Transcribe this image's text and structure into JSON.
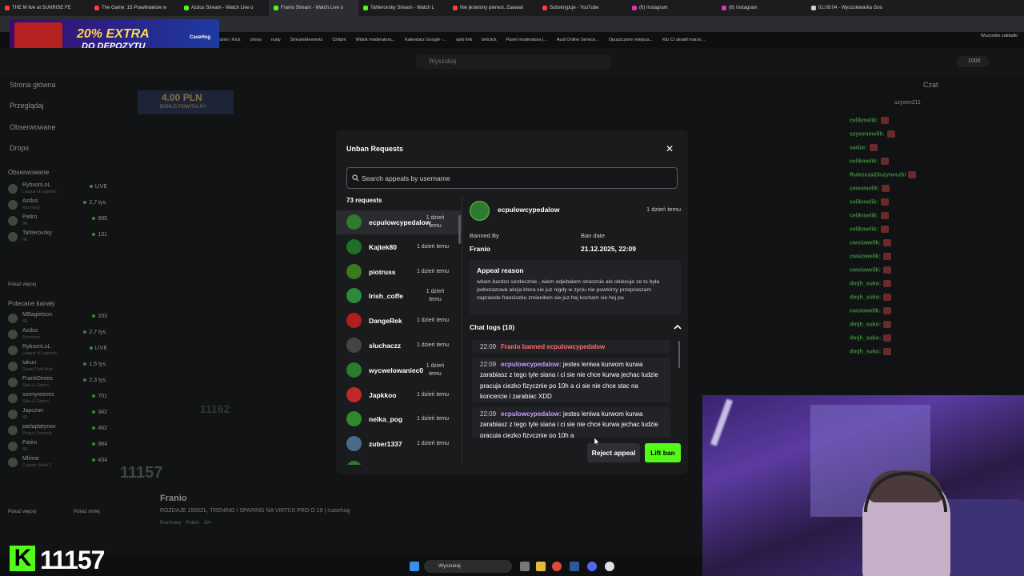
{
  "browser": {
    "tabs": [
      {
        "label": "THE M live at SUNRISE FE",
        "color": "#ff3b3b"
      },
      {
        "label": "The Game: 15 Prawilniaków w",
        "color": "#ff3b3b"
      },
      {
        "label": "Azdus Stream - Watch Live o",
        "color": "#53fc18"
      },
      {
        "label": "Franio Stream - Watch Live o",
        "color": "#53fc18"
      },
      {
        "label": "Tahlerovsky Stream - Watch L",
        "color": "#53fc18"
      },
      {
        "label": "Nie jesteśmy pierwsi. Zaawan",
        "color": "#ff3b3b"
      },
      {
        "label": "Subskrypcje - YouTube",
        "color": "#ff3b3b"
      },
      {
        "label": "(6) Instagram",
        "color": "#d63ab5"
      },
      {
        "label": "(6) Instagram",
        "color": "#d63ab5"
      },
      {
        "label": "01:09:04 - Wyszukiwarka Goo",
        "color": "#cccccc"
      }
    ],
    "bookmarks": [
      "Franio | Kick",
      "chess",
      "nudy",
      "StreamElements",
      "Chilam",
      "Widok moderatora...",
      "Kalendarz Google -...",
      "ujeb link",
      "betclick",
      "Panel moderatora |...",
      "Audi Online Service...",
      "Opuszczone miejsca...",
      "Kto Ci ukradł marze..."
    ],
    "bookmarks_right": "Wszystkie zakładki"
  },
  "ad": {
    "line1": "20% EXTRA",
    "line2": "DO DEPOZYTU",
    "brand": "CaseHug"
  },
  "kick": {
    "search_placeholder": "Wyszukaj",
    "coins": "1000",
    "nav": [
      "Strona główna",
      "Przeglądaj",
      "Obserwowane",
      "Drops"
    ],
    "following_header": "Obserwowane",
    "following": [
      {
        "name": "RybsonLoL",
        "game": "League of Legends",
        "viewers": "LIVE"
      },
      {
        "name": "Azdus",
        "game": "Rozmowy",
        "viewers": "2,7 tys."
      },
      {
        "name": "Patiro",
        "game": "IRL",
        "viewers": "995"
      },
      {
        "name": "Tahlerovsky",
        "game": "IRL",
        "viewers": "131"
      }
    ],
    "show_more": "Pokaż więcej",
    "recommended_header": "Polecane kanały",
    "recommended": [
      {
        "name": "MBagietson",
        "game": "IRL",
        "viewers": "203"
      },
      {
        "name": "Azdus",
        "game": "Rozmowy",
        "viewers": "2,7 tys."
      },
      {
        "name": "RybsonLoL",
        "game": "League of Legends",
        "viewers": "LIVE"
      },
      {
        "name": "takuu",
        "game": "Grand Theft Auto",
        "viewers": "1,5 tys."
      },
      {
        "name": "FrankDimes",
        "game": "Slots & Casino",
        "viewers": "2,3 tys."
      },
      {
        "name": "sonnyreeves",
        "game": "Slots & Casino",
        "viewers": "701"
      },
      {
        "name": "Japczan",
        "game": "IRL",
        "viewers": "342"
      },
      {
        "name": "parlaplatynov",
        "game": "Project Zomboid",
        "viewers": "462"
      },
      {
        "name": "Patiro",
        "game": "IRL",
        "viewers": "984"
      },
      {
        "name": "Mlirine",
        "game": "Counter-Strike 2",
        "viewers": "434"
      }
    ],
    "show_more2": "Pokaż więcej",
    "show_less": "Pokaż mniej",
    "chat_title": "Czat",
    "chat_pinned": "szyxen211",
    "chat_messages": [
      "celikmelik:",
      "szyxenmelik:",
      "sadze:",
      "celikmelik:",
      "Rulezcza23szyneczki",
      "cewsmelik:",
      "celikmelik:",
      "celikmelik:",
      "celikmelik:",
      "cwsiowelik:",
      "cwsiowelik:",
      "cwsiowelik:",
      "dmjh_suko:",
      "dmjh_suko:",
      "cwsiowelik:",
      "dmjh_suko:",
      "dmjh_suko:",
      "dmjh_suko:"
    ],
    "viewer_count_bg": "11157",
    "streamer": "Franio",
    "stream_title": "ROZDAJE 1500ZŁ, TRENING I SPARING NA VIRTUS PRO O 19 | !casehug",
    "stream_tags": [
      "Rozmowy",
      "Polish",
      "18+"
    ],
    "big_viewers": "11157",
    "overlay_bonus": "4.00 PLN",
    "overlay_bonus_sub": "BONUS POWITALNY",
    "overlay_count": "11162"
  },
  "taskbar": {
    "search": "Wyszukaj"
  },
  "modal": {
    "title": "Unban Requests",
    "search_placeholder": "Search appeals by username",
    "count_label": "73 requests",
    "requests": [
      {
        "name": "ecpulowcypedalow",
        "time": "1 dzień temu",
        "color": "#2e7a2e"
      },
      {
        "name": "Kajtek80",
        "time": "1 dzień temu",
        "color": "#1f6f2a"
      },
      {
        "name": "piotruss",
        "time": "1 dzień temu",
        "color": "#3a7a1e"
      },
      {
        "name": "Irish_coffe",
        "time": "1 dzień temu",
        "color": "#2a8a3a"
      },
      {
        "name": "DangeRek",
        "time": "1 dzień temu",
        "color": "#b01e1e"
      },
      {
        "name": "sluchaczz",
        "time": "1 dzień temu",
        "color": "#444444"
      },
      {
        "name": "wycwelowaniec0",
        "time": "1 dzień temu",
        "color": "#2e7a2e"
      },
      {
        "name": "Japkkoo",
        "time": "1 dzień temu",
        "color": "#c0282a"
      },
      {
        "name": "nelka_pog",
        "time": "1 dzień temu",
        "color": "#2e8a2e"
      },
      {
        "name": "zuber1337",
        "time": "1 dzień temu",
        "color": "#4a6a8a"
      },
      {
        "name": "",
        "time": "1 dzień temu",
        "color": "#2e7a2e"
      }
    ],
    "detail": {
      "username": "ecpulowcypedalow",
      "time": "1 dzień temu",
      "banned_by_label": "Banned By",
      "banned_by": "Franio",
      "ban_date_label": "Ban date",
      "ban_date": "21.12.2025, 22:09",
      "appeal_label": "Appeal reason",
      "appeal_text": "witam bardzo serdecznie , wiem odjebalem strasznie ale obiecuje ze to była jednorazowa akcja ktora sie juz nigdy w zyciu nie powtórzy przepraszam naprawde franciszku zmienilem sie juz hej kocham cie hej pa",
      "logs_label": "Chat logs (10)",
      "logs": [
        {
          "time": "22:09",
          "user": "",
          "system": "Franio banned ecpulowcypedalow",
          "text": ""
        },
        {
          "time": "22:09",
          "user": "ecpulowcypedalow:",
          "system": "",
          "text": "jestes leniwa kurwom kurwa zarabiasz z tego tyle siana i ci sie nie chce kurwa jechac ludzie pracuja ciezko fizycznie po 10h a ci sie nie chce stac na koncercie i zarabiac XDD"
        },
        {
          "time": "22:09",
          "user": "ecpulowcypedalow:",
          "system": "",
          "text": "jestes leniwa kurwom kurwa zarabiasz z tego tyle siana i ci sie nie chce kurwa jechac ludzie pracuja ciezko fizycznie po 10h a"
        }
      ]
    },
    "reject_label": "Reject appeal",
    "lift_label": "Lift ban"
  }
}
